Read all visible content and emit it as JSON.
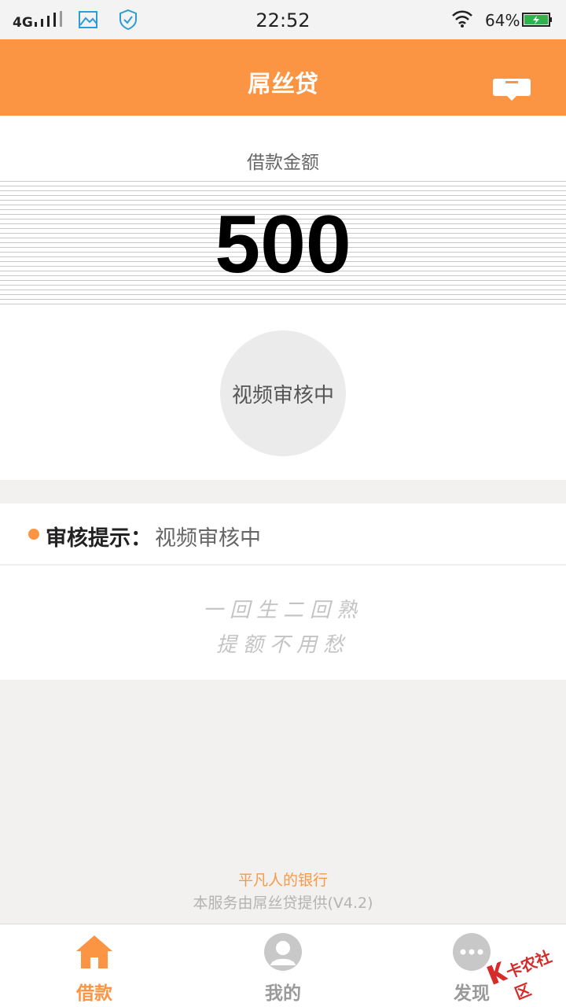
{
  "status_bar": {
    "network": "4G",
    "time": "22:52",
    "battery": "64%",
    "icons": [
      "signal-icon",
      "gallery-icon",
      "shield-icon",
      "wifi-icon",
      "battery-icon"
    ]
  },
  "header": {
    "title": "屌丝贷",
    "message_icon": "message-icon"
  },
  "loan": {
    "amount_label": "借款金额",
    "amount": "500",
    "status": "视频审核中"
  },
  "review": {
    "label": "审核提示：",
    "value": "视频审核中"
  },
  "slogan": {
    "line1": "一回生二回熟",
    "line2": "提额不用愁"
  },
  "footer": {
    "brand": "平凡人的银行",
    "service": "本服务由屌丝贷提供(V4.2)"
  },
  "tabs": [
    {
      "label": "借款",
      "icon": "home-icon",
      "active": true
    },
    {
      "label": "我的",
      "icon": "user-icon",
      "active": false
    },
    {
      "label": "发现",
      "icon": "more-icon",
      "active": false
    }
  ],
  "watermark": {
    "text": "卡农社区"
  },
  "colors": {
    "accent": "#fc9543",
    "inactive": "#9a9a9a",
    "background": "#f2f1ef"
  }
}
